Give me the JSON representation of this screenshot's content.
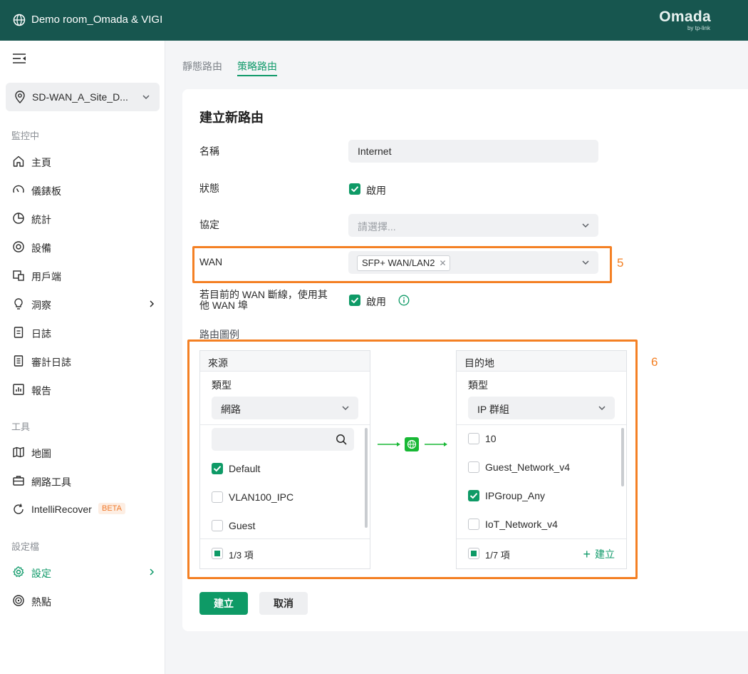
{
  "header": {
    "site_title": "Demo room_Omada & VIGI",
    "brand": "Omada",
    "brand_sub": "by tp-link"
  },
  "sidebar": {
    "site_selector": "SD-WAN_A_Site_D...",
    "sections": {
      "monitoring": "監控中",
      "tools": "工具",
      "profiles": "設定檔"
    },
    "items": [
      {
        "label": "主頁",
        "icon": "home-icon"
      },
      {
        "label": "儀錶板",
        "icon": "dashboard-icon"
      },
      {
        "label": "統計",
        "icon": "statistics-icon"
      },
      {
        "label": "設備",
        "icon": "devices-icon"
      },
      {
        "label": "用戶端",
        "icon": "clients-icon"
      },
      {
        "label": "洞察",
        "icon": "insight-icon"
      },
      {
        "label": "日誌",
        "icon": "log-icon"
      },
      {
        "label": "審計日誌",
        "icon": "audit-log-icon"
      },
      {
        "label": "報告",
        "icon": "report-icon"
      },
      {
        "label": "地圖",
        "icon": "map-icon"
      },
      {
        "label": "網路工具",
        "icon": "network-tools-icon"
      },
      {
        "label": "IntelliRecover",
        "icon": "intellirecover-icon",
        "badge": "BETA"
      },
      {
        "label": "設定",
        "icon": "settings-icon",
        "active": true
      },
      {
        "label": "熱點",
        "icon": "hotspot-icon"
      }
    ]
  },
  "tabs": {
    "static": "靜態路由",
    "policy": "策略路由",
    "active": "策略路由"
  },
  "form": {
    "title": "建立新路由",
    "name_label": "名稱",
    "name_value": "Internet",
    "status_label": "狀態",
    "status_check": "啟用",
    "protocol_label": "協定",
    "protocol_placeholder": "請選擇...",
    "wan_label": "WAN",
    "wan_tag": "SFP+ WAN/LAN2",
    "failover_label_1": "若目前的 WAN 斷線，使用其",
    "failover_label_2": "他 WAN 埠",
    "failover_check": "啟用",
    "route_diagram_label": "路由圖例"
  },
  "annotations": {
    "wan_marker": "5",
    "route_marker": "6"
  },
  "source_panel": {
    "title": "來源",
    "type_label": "類型",
    "type_value": "網路",
    "items": [
      {
        "label": "Default",
        "checked": true
      },
      {
        "label": "VLAN100_IPC",
        "checked": false
      },
      {
        "label": "Guest",
        "checked": false
      }
    ],
    "count": "1/3 項"
  },
  "destination_panel": {
    "title": "目的地",
    "type_label": "類型",
    "type_value": "IP 群組",
    "items": [
      {
        "label": "10",
        "checked": false
      },
      {
        "label": "Guest_Network_v4",
        "checked": false
      },
      {
        "label": "IPGroup_Any",
        "checked": true
      },
      {
        "label": "IoT_Network_v4",
        "checked": false
      }
    ],
    "count": "1/7 項",
    "create": "建立"
  },
  "buttons": {
    "create": "建立",
    "cancel": "取消"
  },
  "colors": {
    "header_bg": "#17564f",
    "accent": "#0e9a66",
    "highlight": "#f48024"
  }
}
